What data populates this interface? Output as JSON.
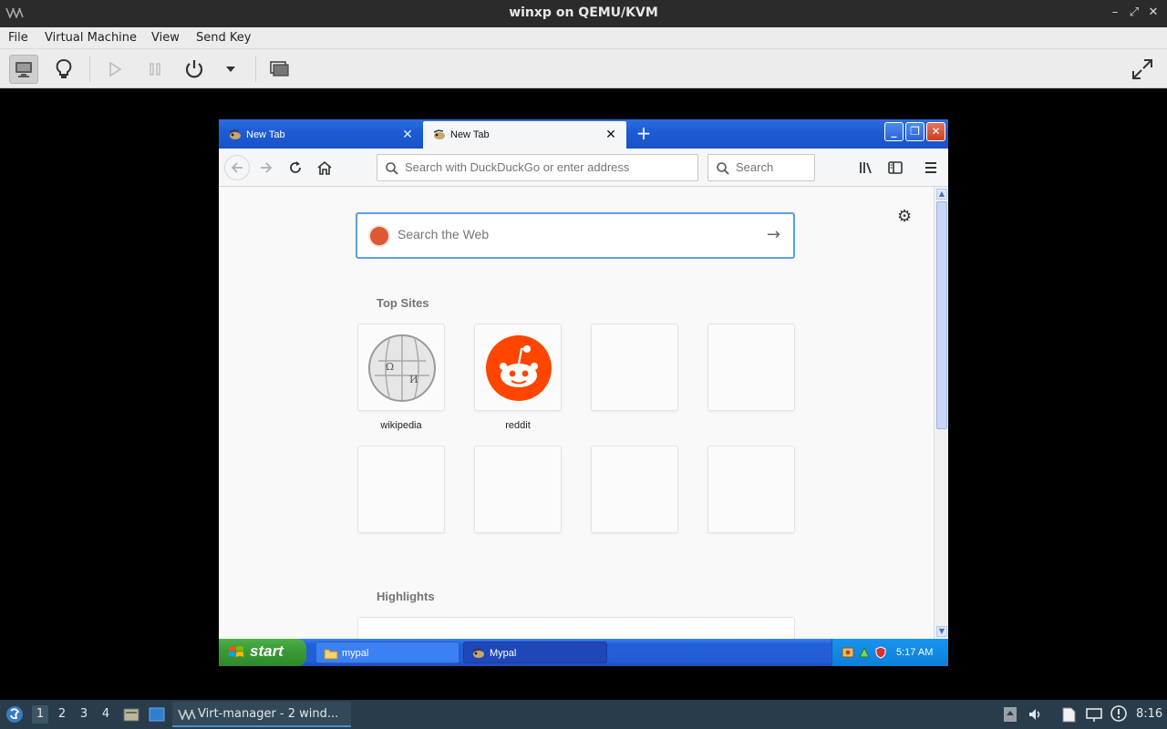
{
  "host_window": {
    "title": "winxp on QEMU/KVM",
    "controls": {
      "minimize": "–",
      "maximize": "⤢",
      "close": "✕"
    }
  },
  "menu": {
    "items": [
      "File",
      "Virtual Machine",
      "View",
      "Send Key"
    ]
  },
  "toolbar": {
    "buttons": [
      "console-view",
      "details-view",
      "run",
      "pause",
      "power",
      "power-menu",
      "snapshots",
      "fullscreen"
    ]
  },
  "guest": {
    "browser": {
      "tabs": [
        {
          "label": "New Tab",
          "active": false,
          "close": "✕"
        },
        {
          "label": "New Tab",
          "active": true,
          "close": "✕"
        }
      ],
      "new_tab": "+",
      "window_controls": {
        "minimize": "_",
        "maximize": "❐",
        "close": "✕"
      },
      "url_placeholder": "Search with DuckDuckGo or enter address",
      "search_placeholder": "Search",
      "content": {
        "web_search_placeholder": "Search the Web",
        "top_sites_title": "Top Sites",
        "top_sites": [
          {
            "label": "wikipedia",
            "icon": "wikipedia-globe-icon"
          },
          {
            "label": "reddit",
            "icon": "reddit-alien-icon"
          },
          {
            "label": "",
            "icon": ""
          },
          {
            "label": "",
            "icon": ""
          },
          {
            "label": "",
            "icon": ""
          },
          {
            "label": "",
            "icon": ""
          },
          {
            "label": "",
            "icon": ""
          },
          {
            "label": "",
            "icon": ""
          }
        ],
        "highlights_title": "Highlights"
      }
    },
    "taskbar": {
      "start_label": "start",
      "tasks": [
        {
          "label": "mypal",
          "icon": "folder-icon",
          "active": false
        },
        {
          "label": "Mypal",
          "icon": "mypal-icon",
          "active": true
        }
      ],
      "clock": "5:17 AM"
    }
  },
  "host_panel": {
    "workspaces": [
      "1",
      "2",
      "3",
      "4"
    ],
    "active_workspace": "1",
    "task_label": "Virt-manager - 2 wind...",
    "clock": "8:16"
  },
  "colors": {
    "xp_blue": "#245dd6",
    "xp_start_green": "#3c9b36",
    "ddg_orange": "#de5833",
    "reddit_orange": "#ff4500",
    "host_panel": "#283c4c"
  }
}
